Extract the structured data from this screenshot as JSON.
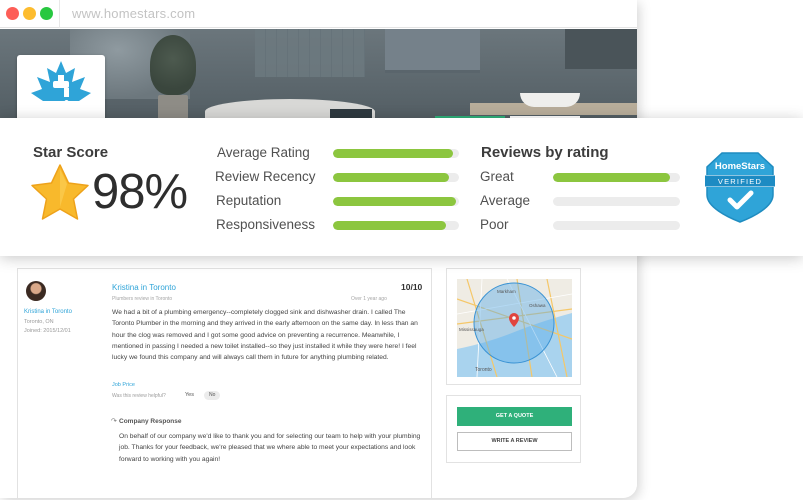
{
  "browser": {
    "url": "www.homestars.com"
  },
  "score_panel": {
    "star_score_title": "Star Score",
    "star_score_value": "98%",
    "metrics": [
      {
        "label": "Average Rating",
        "value": 0.95
      },
      {
        "label": "Review Recency",
        "value": 0.92
      },
      {
        "label": "Reputation",
        "value": 0.98
      },
      {
        "label": "Responsiveness",
        "value": 0.9
      }
    ],
    "reviews_by_rating_title": "Reviews by rating",
    "rating_breakdown": [
      {
        "label": "Great",
        "value": 0.92
      },
      {
        "label": "Average",
        "value": 0.0
      },
      {
        "label": "Poor",
        "value": 0.0
      }
    ],
    "badge": {
      "brand": "HomeStars",
      "status": "VERIFIED"
    },
    "colors": {
      "bar_fill": "#8cc63f",
      "star": "#f8b92c",
      "badge": "#2fa4d8"
    }
  },
  "review": {
    "reviewer_name": "Kristina in Toronto",
    "reviewer_location": "Toronto, ON",
    "reviewer_joined": "Joined: 2015/12/01",
    "title": "Kristina in Toronto",
    "score": "10/10",
    "subtitle": "Plumbers review in Toronto",
    "ago": "Over 1 year ago",
    "body": "We had a bit of a plumbing emergency--completely clogged sink and dishwasher drain. I called The Toronto Plumber in the morning and they arrived in the early afternoon on the same day. In less than an hour the clog was removed and I got some good advice on preventing a recurrence. Meanwhile, I mentioned in passing I needed a new toilet installed--so they just installed it while they were here! I feel lucky we found this company and will always call them in future for anything plumbing related.",
    "job_price": "Job Price",
    "helpful_question": "Was this review helpful?",
    "helpful_yes": "Yes",
    "helpful_no": "No",
    "company_response_title": "Company Response",
    "company_response_body": "On behalf of our company we'd like to thank you and for selecting our team to help with your plumbing job. Thanks for your feedback, we're pleased that we where able to meet your expectations and look forward to working with you again!"
  },
  "sidebar": {
    "map_labels": [
      "Toronto",
      "Mississauga",
      "Oshawa",
      "Markham"
    ],
    "get_quote": "GET A QUOTE",
    "write_review": "WRITE A REVIEW"
  }
}
